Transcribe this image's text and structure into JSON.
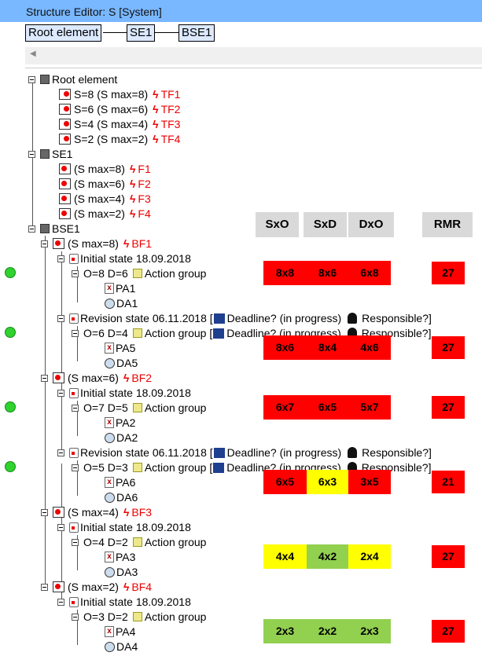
{
  "window": {
    "title": "Structure Editor: S [System]"
  },
  "breadcrumb": [
    "Root element",
    "SE1",
    "BSE1"
  ],
  "tree": [
    {
      "k": "sys",
      "t": "Root element"
    },
    {
      "k": "tf",
      "t": "S=8 (S max=8)",
      "f": "TF1"
    },
    {
      "k": "tf",
      "t": "S=6 (S max=6)",
      "f": "TF2"
    },
    {
      "k": "tf",
      "t": "S=4 (S max=4)",
      "f": "TF3"
    },
    {
      "k": "tf",
      "t": "S=2 (S max=2)",
      "f": "TF4"
    },
    {
      "k": "sys",
      "t": "SE1"
    },
    {
      "k": "tf",
      "fi": "bf",
      "t": "(S max=8)",
      "f": "F1"
    },
    {
      "k": "tf",
      "fi": "bf",
      "t": "(S max=6)",
      "f": "F2"
    },
    {
      "k": "tf",
      "fi": "bf",
      "t": "(S max=4)",
      "f": "F3"
    },
    {
      "k": "tf",
      "fi": "bf",
      "t": "(S max=2)",
      "f": "F4"
    },
    {
      "k": "sys",
      "t": "BSE1"
    },
    {
      "k": "bf",
      "t": "(S max=8)",
      "f": "BF1"
    },
    {
      "k": "st",
      "t": "Initial state 18.09.2018"
    },
    {
      "k": "od",
      "t": "O=8 D=6",
      "ag": "Action group"
    },
    {
      "k": "pa",
      "t": "PA1"
    },
    {
      "k": "da",
      "t": "DA1"
    },
    {
      "k": "st",
      "t": "Revision state 06.11.2018",
      "dl": "Deadline? (in progress)",
      "rs": "Responsible?]"
    },
    {
      "k": "od",
      "t": "O=6 D=4",
      "ag": "Action group",
      "dl": "Deadline? (in progress)",
      "rs": "Responsible?]"
    },
    {
      "k": "pa",
      "t": "PA5"
    },
    {
      "k": "da",
      "t": "DA5"
    },
    {
      "k": "bf",
      "t": "(S max=6)",
      "f": "BF2"
    },
    {
      "k": "st",
      "t": "Initial state 18.09.2018"
    },
    {
      "k": "od",
      "t": "O=7 D=5",
      "ag": "Action group"
    },
    {
      "k": "pa",
      "t": "PA2"
    },
    {
      "k": "da",
      "t": "DA2"
    },
    {
      "k": "st",
      "t": "Revision state 06.11.2018",
      "dl": "Deadline? (in progress)",
      "rs": "Responsible?]"
    },
    {
      "k": "od",
      "t": "O=5 D=3",
      "ag": "Action group",
      "dl": "Deadline? (in progress)",
      "rs": "Responsible?]"
    },
    {
      "k": "pa",
      "t": "PA6"
    },
    {
      "k": "da",
      "t": "DA6"
    },
    {
      "k": "bf",
      "t": "(S max=4)",
      "f": "BF3"
    },
    {
      "k": "st",
      "t": "Initial state 18.09.2018"
    },
    {
      "k": "od",
      "t": "O=4 D=2",
      "ag": "Action group"
    },
    {
      "k": "pa",
      "t": "PA3"
    },
    {
      "k": "da",
      "t": "DA3"
    },
    {
      "k": "bf",
      "t": "(S max=2)",
      "f": "BF4"
    },
    {
      "k": "st",
      "t": "Initial state 18.09.2018"
    },
    {
      "k": "od",
      "t": "O=3 D=2",
      "ag": "Action group"
    },
    {
      "k": "pa",
      "t": "PA4"
    },
    {
      "k": "da",
      "t": "DA4"
    }
  ],
  "matrix": {
    "headers": [
      "SxO",
      "SxD",
      "DxO",
      "RMR"
    ],
    "colors": {
      "red": "#ff0000",
      "yellow": "#ffff00",
      "green": "#92d050",
      "header": "#d9d9d9"
    },
    "rows": [
      {
        "row": 13,
        "cells": [
          [
            "8x8",
            "red"
          ],
          [
            "8x6",
            "red"
          ],
          [
            "6x8",
            "red"
          ]
        ],
        "rmr": "27"
      },
      {
        "row": 18,
        "cells": [
          [
            "8x6",
            "red"
          ],
          [
            "8x4",
            "red"
          ],
          [
            "4x6",
            "red"
          ]
        ],
        "rmr": "27"
      },
      {
        "row": 22,
        "cells": [
          [
            "6x7",
            "red"
          ],
          [
            "6x5",
            "red"
          ],
          [
            "5x7",
            "red"
          ]
        ],
        "rmr": "27"
      },
      {
        "row": 27,
        "cells": [
          [
            "6x5",
            "red"
          ],
          [
            "6x3",
            "yellow"
          ],
          [
            "3x5",
            "red"
          ]
        ],
        "rmr": "21"
      },
      {
        "row": 32,
        "cells": [
          [
            "4x4",
            "yellow"
          ],
          [
            "4x2",
            "green"
          ],
          [
            "2x4",
            "yellow"
          ]
        ],
        "rmr": "27"
      },
      {
        "row": 37,
        "cells": [
          [
            "2x3",
            "green"
          ],
          [
            "2x2",
            "green"
          ],
          [
            "2x3",
            "green"
          ]
        ],
        "rmr": "27"
      }
    ]
  },
  "status_dots": [
    13,
    17,
    22,
    26
  ]
}
